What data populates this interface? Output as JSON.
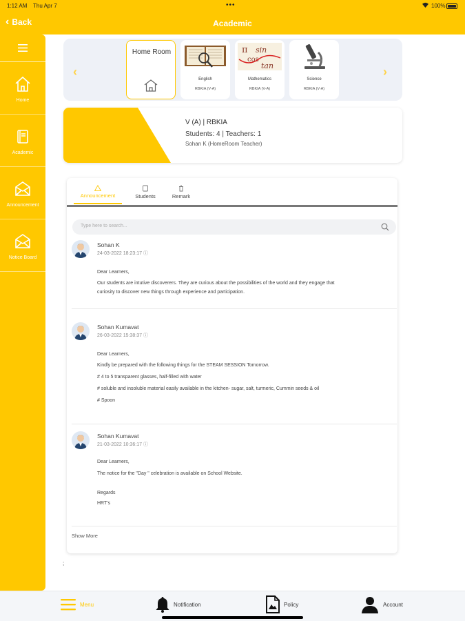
{
  "status_bar": {
    "time": "1:12 AM",
    "date": "Thu Apr 7",
    "dots": "•••",
    "battery": "100%"
  },
  "header": {
    "back_label": "Back",
    "title": "Academic"
  },
  "sidebar": {
    "items": [
      {
        "label": "Home"
      },
      {
        "label": "Academic"
      },
      {
        "label": "Announcement"
      },
      {
        "label": "Notice Board"
      }
    ]
  },
  "subjects": {
    "homeroom_label": "Home Room",
    "cards": [
      {
        "name": "English",
        "sub": "RBKIA (V-A)"
      },
      {
        "name": "Mathematics",
        "sub": "RBKIA (V-A)"
      },
      {
        "name": "Science",
        "sub": "RBKIA (V-A)"
      }
    ]
  },
  "class_info": {
    "class_name": "V (A) | RBKIA",
    "counts": "Students: 4 | Teachers: 1",
    "teacher": "Sohan K (HomeRoom Teacher)"
  },
  "tabs": [
    {
      "label": "Announcement"
    },
    {
      "label": "Students"
    },
    {
      "label": "Remark"
    }
  ],
  "search": {
    "placeholder": "Type here to search..."
  },
  "posts": [
    {
      "author": "Sohan K",
      "timestamp": "24-03-2022 18:23:17",
      "lines": [
        "Dear Learners,",
        "Our students are intutive discoverers. They are curious about the possibilities of the world and they engage that",
        "curiosity to discover new things through experience and participation."
      ]
    },
    {
      "author": "Sohan Kumavat",
      "timestamp": "26-03-2022 15:38:37",
      "lines": [
        "Dear Learners,",
        "Kindly be prepared with the following things for the STEAM SESSION Tomorrow.",
        "# 4 to 5 transparent glasses, half-filled with water",
        "# soluble and insoluble material easily available in the kitchen- sugar, salt, turmeric, Cummin seeds & oil",
        "# Spoon"
      ]
    },
    {
      "author": "Sohan Kumavat",
      "timestamp": "21-03-2022 10:36:17",
      "lines": [
        "Dear Learners,",
        "The notice for the \"Day \" celebration is available on School Website.",
        "Regards",
        "HRT's"
      ]
    }
  ],
  "show_more": "Show More",
  "stray_mark": ";",
  "bottom_bar": {
    "menu": "Menu",
    "notification": "Notification",
    "policy": "Policy",
    "account": "Account"
  },
  "colors": {
    "accent": "#ffc800",
    "panel_bg": "#eef1f7"
  }
}
